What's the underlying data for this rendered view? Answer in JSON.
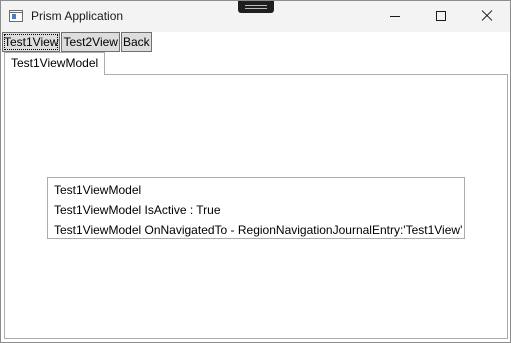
{
  "window": {
    "title": "Prism Application"
  },
  "toolbar": {
    "buttons": [
      {
        "label": "Test1View"
      },
      {
        "label": "Test2View"
      },
      {
        "label": "Back"
      }
    ]
  },
  "tabs": [
    {
      "label": "Test1ViewModel",
      "selected": true
    }
  ],
  "log": {
    "items": [
      "Test1ViewModel",
      "Test1ViewModel IsActive : True",
      "Test1ViewModel OnNavigatedTo - RegionNavigationJournalEntry:'Test1View'"
    ]
  },
  "icons": {
    "app": "window-app-icon",
    "minimize": "minimize-icon",
    "maximize": "maximize-icon",
    "close": "close-icon"
  }
}
